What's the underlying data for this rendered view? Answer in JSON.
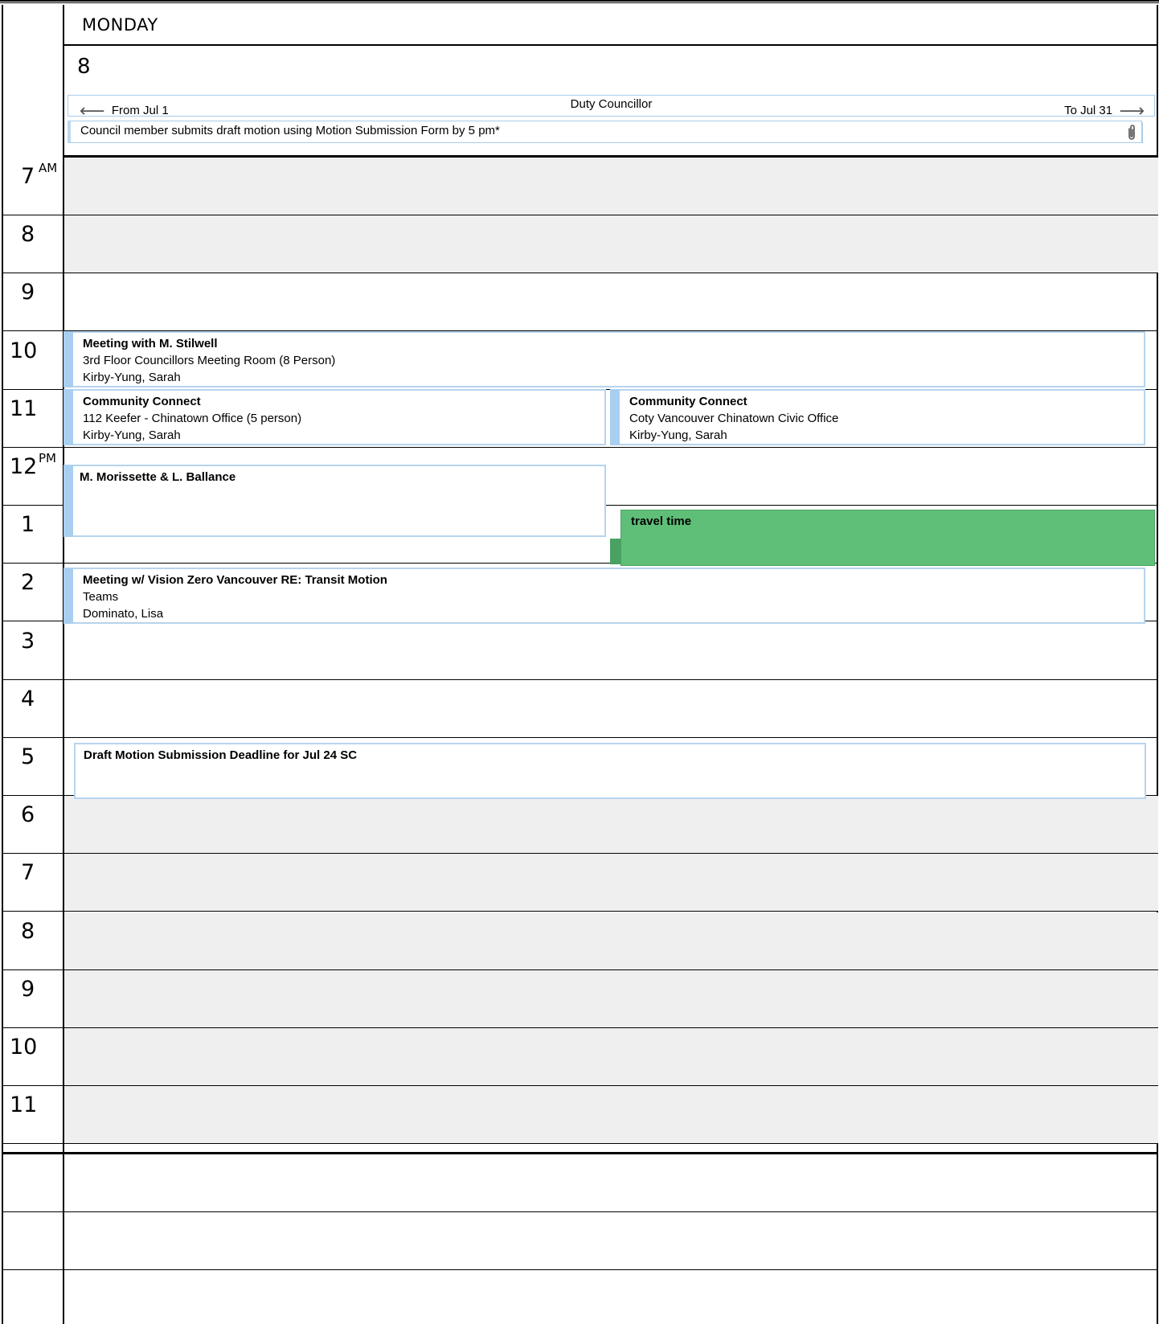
{
  "header": {
    "weekday": "MONDAY",
    "date": "8"
  },
  "all_day": {
    "banner": {
      "from_label": "From Jul 1",
      "title": "Duty Councillor",
      "to_label": "To Jul 31"
    },
    "note": {
      "text": "Council member submits draft motion using Motion Submission Form by 5 pm*",
      "icon": "paperclip-icon"
    }
  },
  "hours": [
    {
      "num": "7",
      "ampm": "AM"
    },
    {
      "num": "8",
      "ampm": ""
    },
    {
      "num": "9",
      "ampm": ""
    },
    {
      "num": "10",
      "ampm": ""
    },
    {
      "num": "11",
      "ampm": ""
    },
    {
      "num": "12",
      "ampm": "PM"
    },
    {
      "num": "1",
      "ampm": ""
    },
    {
      "num": "2",
      "ampm": ""
    },
    {
      "num": "3",
      "ampm": ""
    },
    {
      "num": "4",
      "ampm": ""
    },
    {
      "num": "5",
      "ampm": ""
    },
    {
      "num": "6",
      "ampm": ""
    },
    {
      "num": "7",
      "ampm": ""
    },
    {
      "num": "8",
      "ampm": ""
    },
    {
      "num": "9",
      "ampm": ""
    },
    {
      "num": "10",
      "ampm": ""
    },
    {
      "num": "11",
      "ampm": ""
    }
  ],
  "events": {
    "stilwell": {
      "title": "Meeting with M. Stilwell",
      "location": "3rd Floor Councillors Meeting Room (8 Person)",
      "organizer": "Kirby-Yung, Sarah"
    },
    "community_connect_1": {
      "title": "Community Connect",
      "location": "112 Keefer - Chinatown Office (5 person)",
      "organizer": "Kirby-Yung, Sarah"
    },
    "community_connect_2": {
      "title": "Community Connect",
      "location": "Coty Vancouver Chinatown Civic Office",
      "organizer": "Kirby-Yung, Sarah"
    },
    "morissette": {
      "title": "M. Morissette & L. Ballance"
    },
    "travel": {
      "title": "travel time"
    },
    "vision_zero": {
      "title": "Meeting w/ Vision Zero Vancouver RE: Transit Motion",
      "location": "Teams",
      "organizer": "Dominato, Lisa"
    },
    "deadline": {
      "title": "Draft Motion Submission Deadline for Jul 24 SC"
    }
  },
  "colors": {
    "event_border": "#b6d4ee",
    "event_bar": "#a8cff0",
    "travel_fill": "#5fbf78",
    "off_hours": "#efefef"
  }
}
